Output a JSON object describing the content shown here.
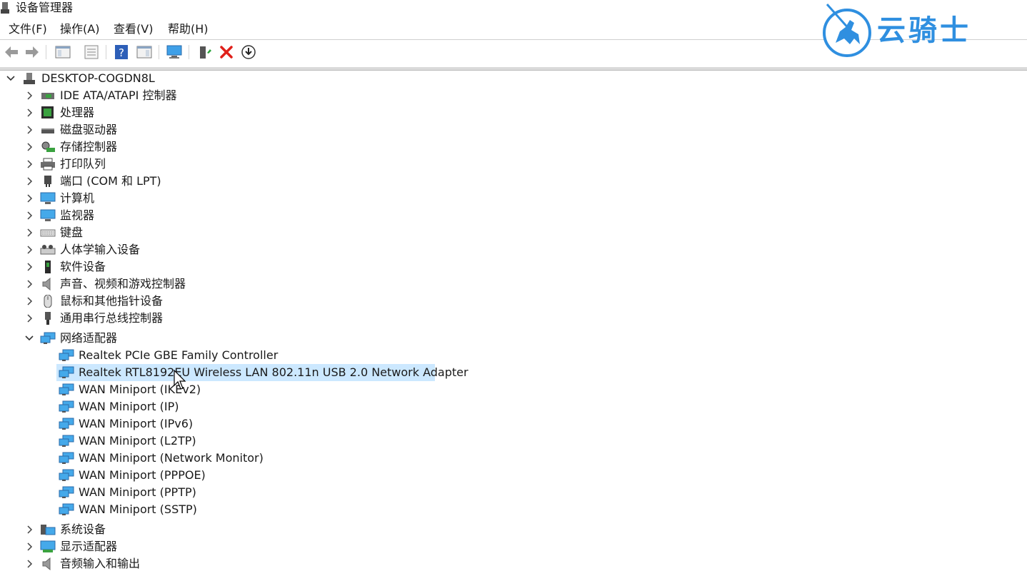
{
  "window": {
    "title": "设备管理器"
  },
  "menu": [
    {
      "label": "文件(F)"
    },
    {
      "label": "操作(A)"
    },
    {
      "label": "查看(V)"
    },
    {
      "label": "帮助(H)"
    }
  ],
  "toolbar": {
    "items": [
      "back-icon",
      "forward-icon",
      "show-hide-tree-icon",
      "properties-icon",
      "help-icon",
      "action-pane-icon",
      "scan-hardware-icon",
      "update-driver-icon",
      "uninstall-icon",
      "download-icon"
    ]
  },
  "tree": {
    "root": "DESKTOP-COGDN8L",
    "categories": [
      {
        "label": "IDE ATA/ATAPI 控制器",
        "icon": "ide-controller-icon"
      },
      {
        "label": "处理器",
        "icon": "processor-icon"
      },
      {
        "label": "磁盘驱动器",
        "icon": "disk-drive-icon"
      },
      {
        "label": "存储控制器",
        "icon": "storage-controller-icon"
      },
      {
        "label": "打印队列",
        "icon": "printer-icon"
      },
      {
        "label": "端口 (COM 和 LPT)",
        "icon": "port-icon"
      },
      {
        "label": "计算机",
        "icon": "computer-icon"
      },
      {
        "label": "监视器",
        "icon": "monitor-icon"
      },
      {
        "label": "键盘",
        "icon": "keyboard-icon"
      },
      {
        "label": "人体学输入设备",
        "icon": "hid-icon"
      },
      {
        "label": "软件设备",
        "icon": "software-device-icon"
      },
      {
        "label": "声音、视频和游戏控制器",
        "icon": "speaker-icon"
      },
      {
        "label": "鼠标和其他指针设备",
        "icon": "mouse-icon"
      },
      {
        "label": "通用串行总线控制器",
        "icon": "usb-icon"
      },
      {
        "label": "网络适配器",
        "icon": "network-icon",
        "expanded": true
      },
      {
        "label": "系统设备",
        "icon": "system-device-icon"
      },
      {
        "label": "显示适配器",
        "icon": "display-adapter-icon"
      },
      {
        "label": "音频输入和输出",
        "icon": "audio-io-icon"
      }
    ],
    "network_children": [
      "Realtek PCIe GBE Family Controller",
      "Realtek RTL8192EU Wireless LAN 802.11n USB 2.0 Network Adapter",
      "WAN Miniport (IKEv2)",
      "WAN Miniport (IP)",
      "WAN Miniport (IPv6)",
      "WAN Miniport (L2TP)",
      "WAN Miniport (Network Monitor)",
      "WAN Miniport (PPPOE)",
      "WAN Miniport (PPTP)",
      "WAN Miniport (SSTP)"
    ],
    "selected_index": 1
  },
  "watermark": {
    "text": "云骑士"
  },
  "colors": {
    "selection": "#cce8ff",
    "accent": "#2f8fe0"
  }
}
